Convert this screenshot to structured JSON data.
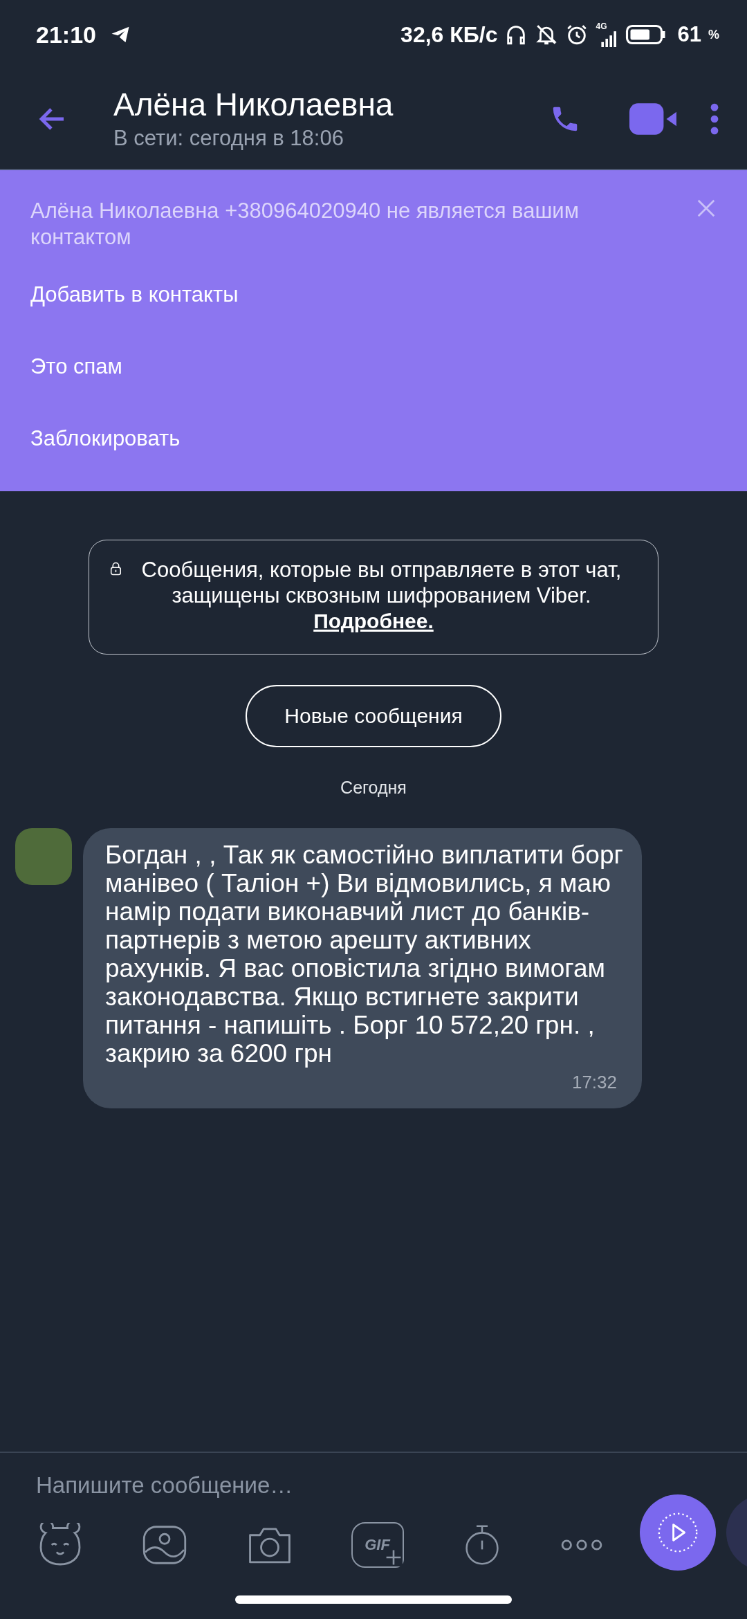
{
  "status_bar": {
    "time": "21:10",
    "speed": "32,6 КБ/с",
    "network": "4G",
    "battery": "61",
    "battery_unit": "%"
  },
  "header": {
    "title": "Алёна Николаевна",
    "subtitle": "В сети: сегодня в 18:06"
  },
  "banner": {
    "text": "Алёна Николаевна +380964020940 не является вашим контактом",
    "actions": [
      "Добавить в контакты",
      "Это спам",
      "Заблокировать"
    ]
  },
  "notice": {
    "text": "Сообщения, которые вы отправляете в этот чат, защищены сквозным шифрованием Viber.",
    "link": "Подробнее."
  },
  "new_messages": "Новые сообщения",
  "date": "Сегодня",
  "messages": [
    {
      "text": "Богдан , , Так як самостійно виплатити борг манівео ( Таліон +) Ви відмовились, я маю намір подати виконавчий лист до банків-партнерів з метою арешту активних рахунків. Я вас оповістила згідно вимогам законодавства. Якщо встигнете закрити питання - напишіть . Борг 10 572,20 грн. , закрию за 6200 грн",
      "time": "17:32"
    }
  ],
  "composer": {
    "placeholder": "Напишите сообщение…",
    "gif": "GIF"
  }
}
